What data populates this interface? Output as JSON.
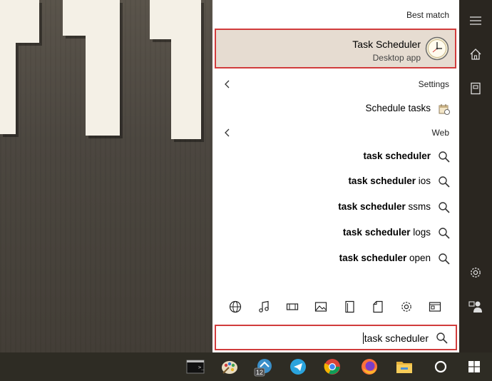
{
  "best_match": {
    "header": "Best match",
    "title": "Task Scheduler",
    "subtitle": "Desktop app"
  },
  "settings": {
    "header": "Settings",
    "items": [
      {
        "label": "Schedule tasks"
      }
    ]
  },
  "web": {
    "header": "Web",
    "items": [
      {
        "bold": "task scheduler",
        "rest": ""
      },
      {
        "bold": "task scheduler",
        "rest": " ios"
      },
      {
        "bold": "task scheduler",
        "rest": " ssms"
      },
      {
        "bold": "task scheduler",
        "rest": " logs"
      },
      {
        "bold": "task scheduler",
        "rest": " open"
      }
    ]
  },
  "search": {
    "value": "task scheduler"
  },
  "filter_icons": [
    "globe-icon",
    "music-icon",
    "video-icon",
    "image-icon",
    "folder-icon",
    "document-icon",
    "settings-icon",
    "apps-icon"
  ],
  "rail_icons": [
    "hamburger-icon",
    "home-icon",
    "documents-icon",
    "gear-icon",
    "user-icon"
  ],
  "taskbar": {
    "badge_count": "12",
    "icons": [
      "terminal-icon",
      "paint-icon",
      "vpn-icon",
      "telegram-icon",
      "chrome-icon",
      "firefox-icon",
      "file-explorer-icon",
      "cortana-icon",
      "windows-start-icon"
    ]
  },
  "colors": {
    "highlight_border": "#d13c3c",
    "best_match_bg": "#e6dcd1",
    "panel_bg": "#ffffff",
    "rail_bg": "#2a2620",
    "taskbar_bg": "#2e2c24"
  }
}
